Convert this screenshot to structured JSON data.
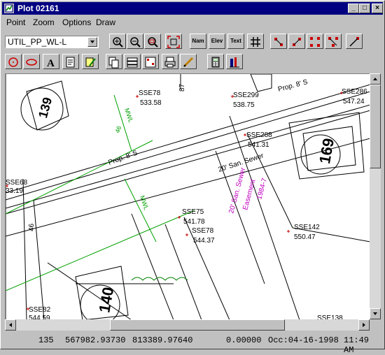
{
  "window": {
    "title": "Plot 02161"
  },
  "titlebar_buttons": {
    "minimize": "_",
    "maximize": "□",
    "close": "×"
  },
  "menu": [
    {
      "label": "Point",
      "key": "P"
    },
    {
      "label": "Zoom",
      "key": "Z"
    },
    {
      "label": "Options",
      "key": "O"
    },
    {
      "label": "Draw",
      "key": "D"
    }
  ],
  "layer_select": {
    "value": "UTIL_PP_WL-L"
  },
  "toolbar": {
    "name_label": "Nam",
    "elev_label": "Elev",
    "text_label": "Text"
  },
  "map": {
    "points": [
      {
        "id": "SSE78",
        "elev": "533.58"
      },
      {
        "id": "SSE299",
        "elev": "538.75"
      },
      {
        "id": "SSE286",
        "elev": "547.24"
      },
      {
        "id": "SSE288",
        "elev": "541.31"
      },
      {
        "id": "SSE68",
        "elev": "33.19"
      },
      {
        "id": "SSE75",
        "elev": "541.78"
      },
      {
        "id": "SSE78",
        "elev": "544.37"
      },
      {
        "id": "SSE142",
        "elev": "550.47"
      },
      {
        "id": "SSE82",
        "elev": "544.59"
      },
      {
        "id": "SSE138",
        "elev": ""
      }
    ],
    "labels": {
      "prop_s_1": "Prop. 8' S",
      "prop_s_2": "Prop. 8' S",
      "sewer_1": "20' San. Sewer",
      "sewer_2": "20' San. Sewer",
      "sewer_3": "Easement",
      "sewer_4": "1984-7",
      "lot_1": "169",
      "lot_2": "140",
      "lot_3": "139",
      "mwl_1": "MWL",
      "mwl_2": "MWL",
      "num_1": "87",
      "num_2": "46",
      "num_3": "46"
    }
  },
  "status": {
    "point": "135",
    "northing": "567982.93730",
    "easting": "813389.97640",
    "elevation": "0.00000",
    "date": "Occ:04-16-1998",
    "time": "11:49 AM"
  },
  "colors": {
    "titlebar": "#000080",
    "point_marker": "#cc0000",
    "green_line": "#00a000",
    "magenta_text": "#c000c0"
  }
}
